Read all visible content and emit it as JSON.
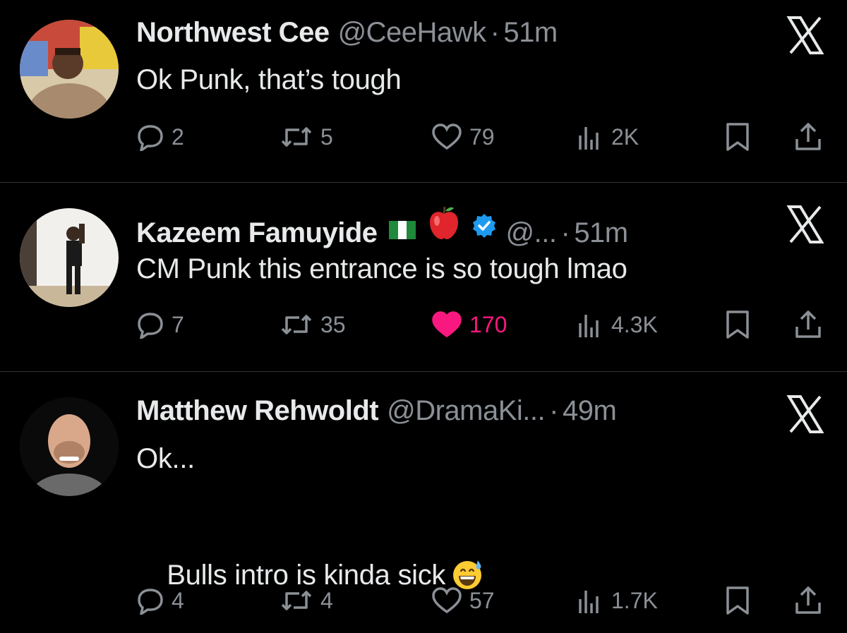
{
  "tweets": [
    {
      "name": "Northwest Cee",
      "handle": "@CeeHawk",
      "dot": "·",
      "time": "51m",
      "text": "Ok Punk, that’s tough",
      "replies": "2",
      "retweets": "5",
      "likes": "79",
      "views": "2K",
      "liked": false
    },
    {
      "name": "Kazeem Famuyide",
      "handle": "@...",
      "dot": "·",
      "time": "51m",
      "text": "CM Punk this entrance is so tough lmao",
      "replies": "7",
      "retweets": "35",
      "likes": "170",
      "views": "4.3K",
      "liked": true
    },
    {
      "name": "Matthew Rehwoldt",
      "handle": "@DramaKi...",
      "dot": "·",
      "time": "49m",
      "text_line1": "Ok...",
      "text_line2": "Bulls intro is kinda sick",
      "replies": "4",
      "retweets": "4",
      "likes": "57",
      "views": "1.7K",
      "liked": false
    }
  ],
  "colors": {
    "background": "#000000",
    "text": "#e7e9ea",
    "muted": "#8b9096",
    "like_active": "#f91880",
    "verified": "#1d9bf0",
    "divider": "#2f3336"
  },
  "icons": [
    "close-x-icon",
    "reply-icon",
    "retweet-icon",
    "like-icon",
    "views-icon",
    "bookmark-icon",
    "share-icon",
    "nigeria-flag-icon",
    "apple-emoji-icon",
    "verified-badge-icon",
    "grinning-sweat-emoji-icon"
  ]
}
